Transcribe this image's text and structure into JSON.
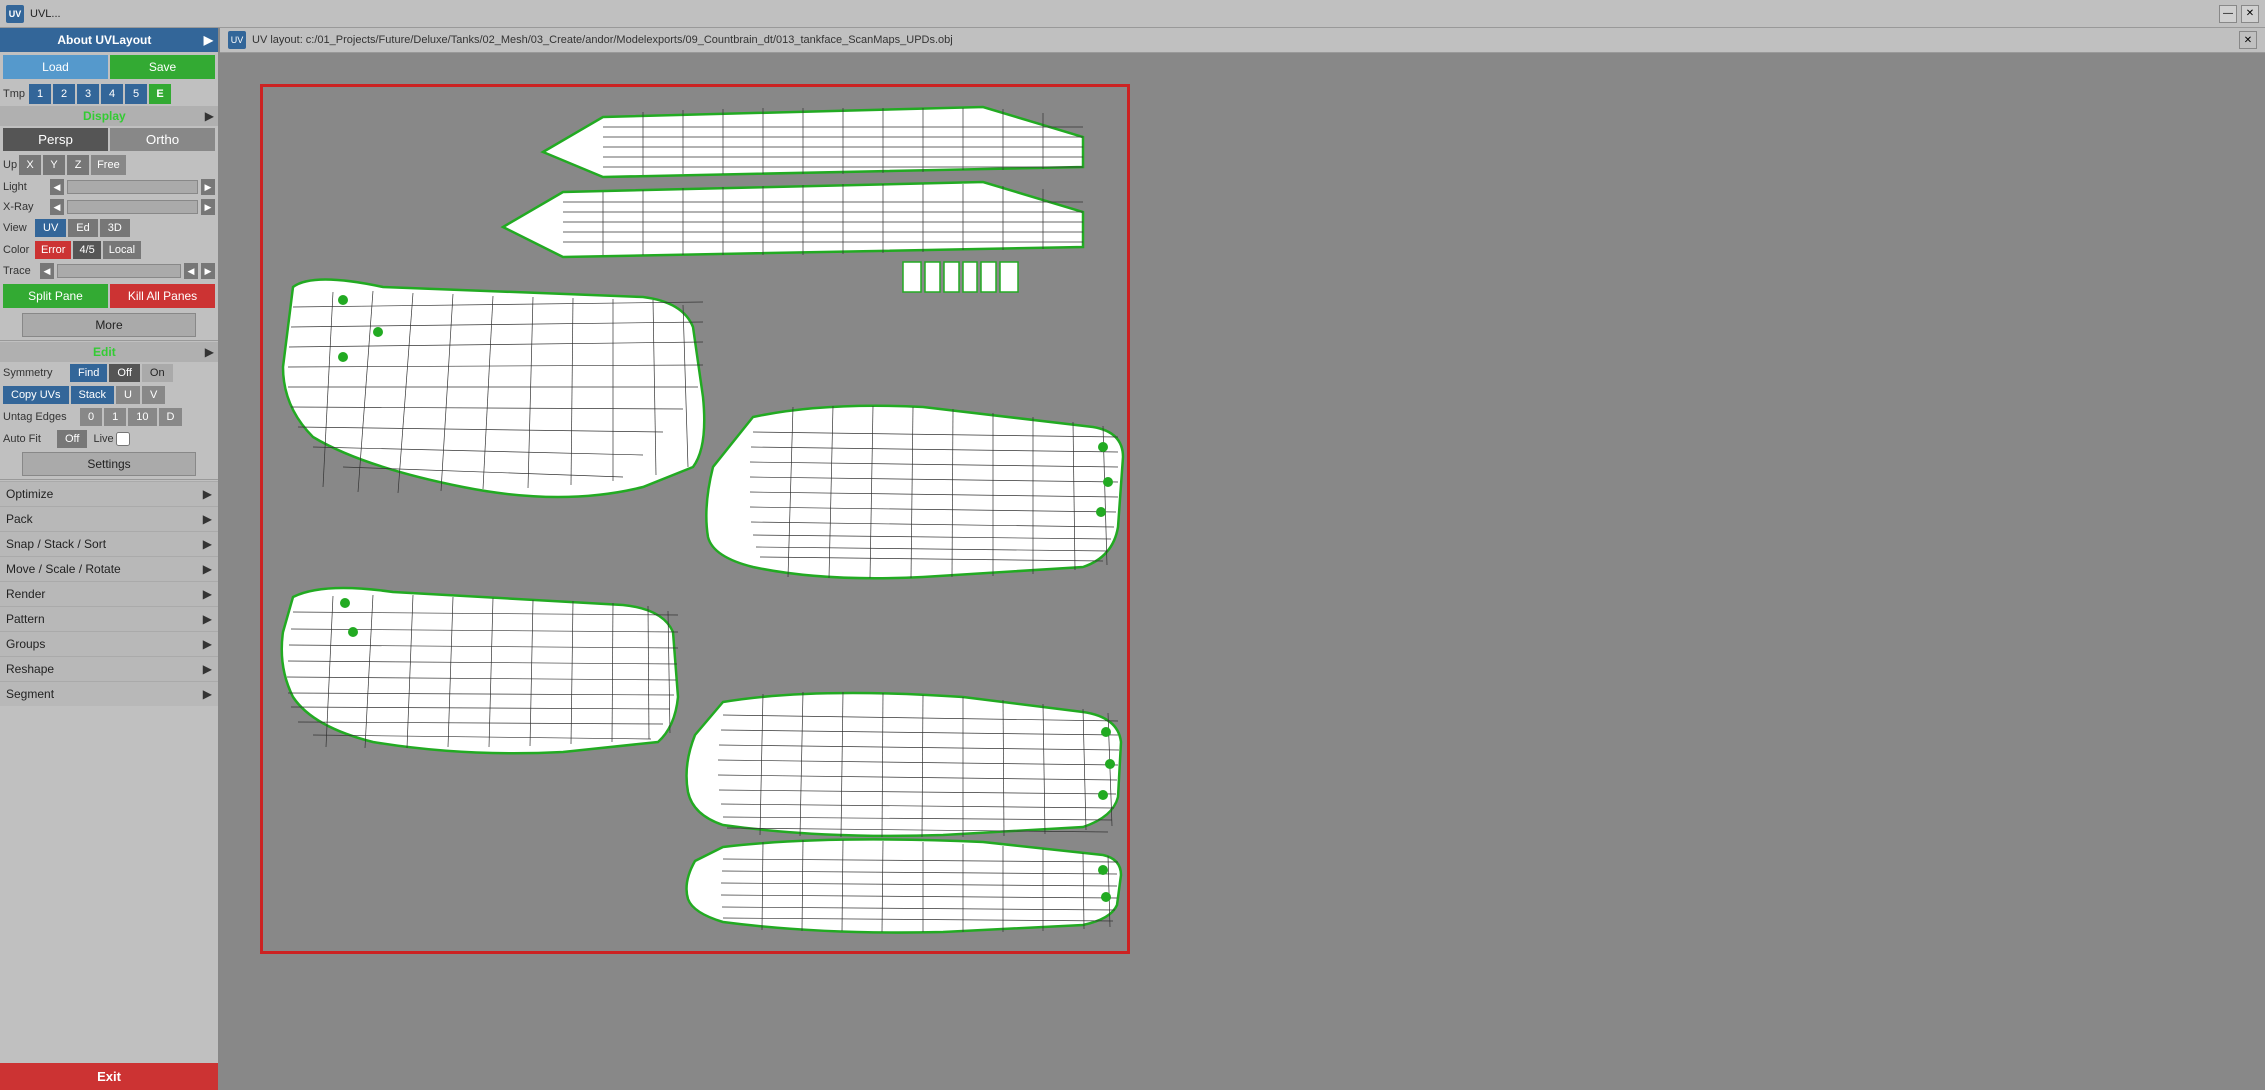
{
  "app": {
    "title": "UVL...",
    "path": "UV layout: c:/01_Projects/Future/Deluxe/Tanks/02_Mesh/03_Create/andor/Modelexports/09_Countbrain_dt/013_tankface_ScanMaps_UPDs.obj",
    "icon": "UV"
  },
  "titlebar": {
    "minimize": "—",
    "close": "✕"
  },
  "sidebar": {
    "about_label": "About UVLayout",
    "load_label": "Load",
    "save_label": "Save",
    "tmp_label": "Tmp",
    "tmp_buttons": [
      "1",
      "2",
      "3",
      "4",
      "5"
    ],
    "tmp_e": "E",
    "display_label": "Display",
    "persp_label": "Persp",
    "ortho_label": "Ortho",
    "up_label": "Up",
    "x_label": "X",
    "y_label": "Y",
    "z_label": "Z",
    "free_label": "Free",
    "light_label": "Light",
    "xray_label": "X-Ray",
    "view_label": "View",
    "uv_label": "UV",
    "ed_label": "Ed",
    "threed_label": "3D",
    "color_label": "Color",
    "error_label": "Error",
    "frac_label": "4/5",
    "local_label": "Local",
    "trace_label": "Trace",
    "split_pane_label": "Split Pane",
    "kill_all_panes_label": "Kill All Panes",
    "more_label": "More",
    "edit_label": "Edit",
    "symmetry_label": "Symmetry",
    "find_label": "Find",
    "off_label": "Off",
    "on_label": "On",
    "copy_uvs_label": "Copy UVs",
    "stack_label": "Stack",
    "u_label": "U",
    "v_label": "V",
    "untag_edges_label": "Untag Edges",
    "untag_0": "0",
    "untag_1": "1",
    "untag_10": "10",
    "untag_d": "D",
    "auto_fit_label": "Auto Fit",
    "auto_fit_off": "Off",
    "live_label": "Live",
    "settings_label": "Settings",
    "optimize_label": "Optimize",
    "pack_label": "Pack",
    "snap_stack_sort_label": "Snap / Stack / Sort",
    "move_scale_rotate_label": "Move / Scale / Rotate",
    "render_label": "Render",
    "pattern_label": "Pattern",
    "groups_label": "Groups",
    "reshape_label": "Reshape",
    "segment_label": "Segment",
    "exit_label": "Exit"
  },
  "colors": {
    "blue": "#336699",
    "green": "#33aa33",
    "red": "#cc3333",
    "green_label": "#33cc33"
  }
}
